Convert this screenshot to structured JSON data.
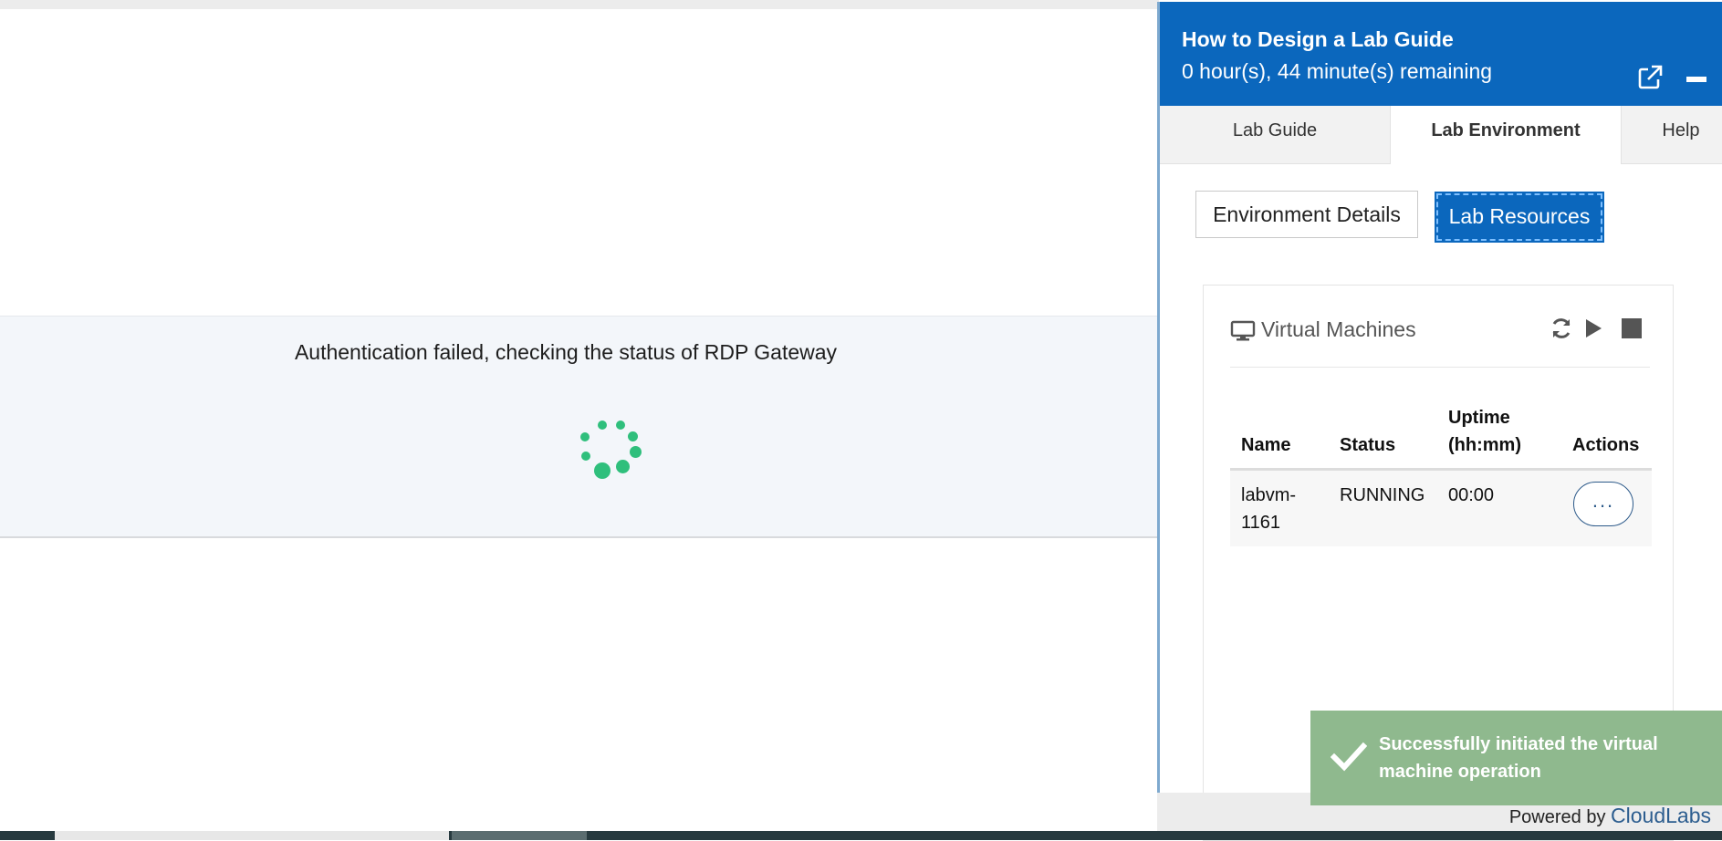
{
  "loading": {
    "message": "Authentication failed, checking the status of RDP Gateway"
  },
  "panel": {
    "title": "How to Design a Lab Guide",
    "time_remaining": "0 hour(s), 44 minute(s) remaining",
    "tabs": [
      {
        "label": "Lab Guide",
        "active": false
      },
      {
        "label": "Lab Environment",
        "active": true
      },
      {
        "label": "Help",
        "active": false
      }
    ],
    "subtabs": {
      "environment_details": "Environment Details",
      "lab_resources": "Lab Resources"
    },
    "vm_section": {
      "title": "Virtual Machines",
      "columns": {
        "name": "Name",
        "status": "Status",
        "uptime_line1": "Uptime",
        "uptime_line2": "(hh:mm)",
        "actions": "Actions"
      },
      "rows": [
        {
          "name_line1": "labvm-",
          "name_line2": "1161",
          "status": "RUNNING",
          "uptime": "00:00",
          "actions_label": "..."
        }
      ]
    }
  },
  "toast": {
    "line1": "Successfully initiated the virtual",
    "line2": "machine operation"
  },
  "footer": {
    "powered_by": "Powered by",
    "brand": "CloudLabs"
  },
  "icons": {
    "external": "external-link-icon",
    "minimize": "minimize-icon",
    "monitor": "monitor-icon",
    "refresh": "refresh-icon",
    "start": "play-icon",
    "stop": "stop-icon",
    "check": "checkmark-icon"
  },
  "colors": {
    "header_blue": "#0b67bd",
    "spinner_green": "#2fbf7c",
    "toast_green": "#8fb98e",
    "brand_blue": "#2c5d8f"
  }
}
